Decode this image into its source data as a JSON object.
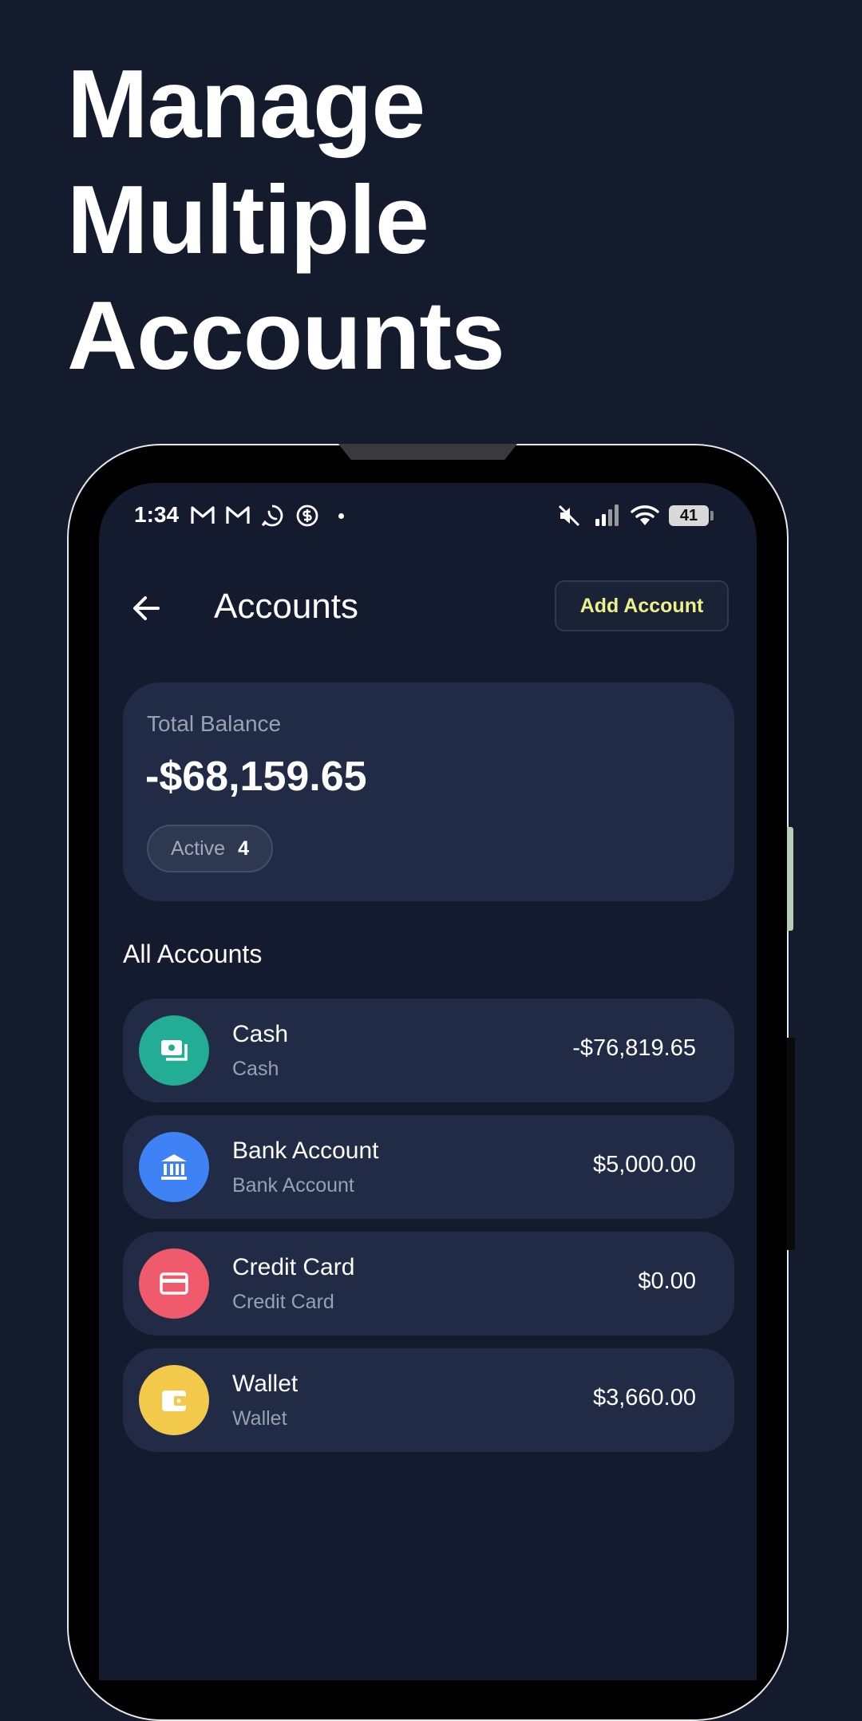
{
  "headline": [
    "Manage",
    "Multiple",
    "Accounts"
  ],
  "status_bar": {
    "time": "1:34",
    "battery": "41"
  },
  "app_bar": {
    "title": "Accounts",
    "add_button": "Add Account"
  },
  "summary": {
    "label": "Total Balance",
    "amount": "-$68,159.65",
    "active_label": "Active",
    "active_count": "4"
  },
  "section_title": "All Accounts",
  "accounts": [
    {
      "name": "Cash",
      "type": "Cash",
      "balance": "-$76,819.65",
      "color": "#22ad94",
      "icon": "cash-icon"
    },
    {
      "name": "Bank Account",
      "type": "Bank Account",
      "balance": "$5,000.00",
      "color": "#3f82f6",
      "icon": "bank-icon"
    },
    {
      "name": "Credit Card",
      "type": "Credit Card",
      "balance": "$0.00",
      "color": "#ef5a6c",
      "icon": "credit-card-icon"
    },
    {
      "name": "Wallet",
      "type": "Wallet",
      "balance": "$3,660.00",
      "color": "#f3c94c",
      "icon": "wallet-icon"
    }
  ]
}
